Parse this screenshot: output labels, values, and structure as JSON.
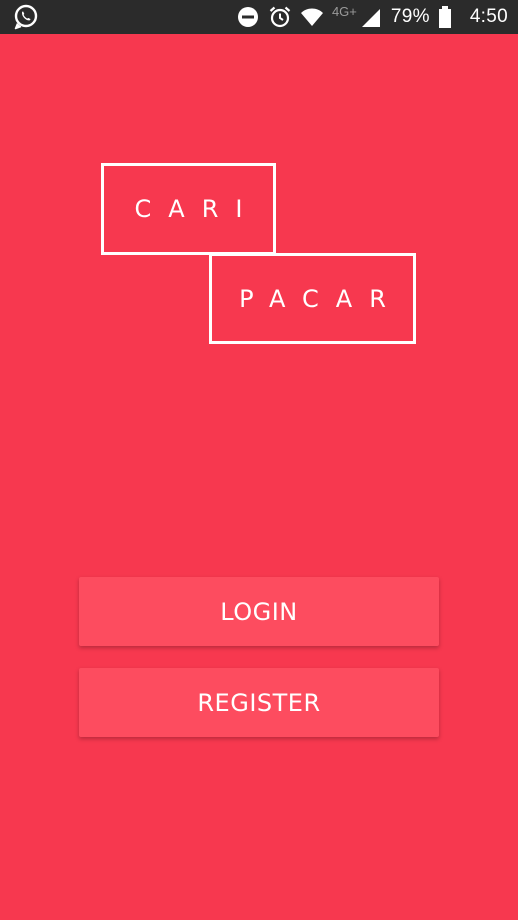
{
  "status_bar": {
    "network_label": "4G+",
    "battery_percent": "79%",
    "time": "4:50",
    "icons": [
      "whatsapp-icon",
      "do-not-disturb-icon",
      "alarm-icon",
      "wifi-icon",
      "cell-signal-icon",
      "battery-icon"
    ]
  },
  "logo": {
    "line1": "CARI",
    "line2": "PACAR"
  },
  "actions": {
    "login_label": "LOGIN",
    "register_label": "REGISTER"
  },
  "colors": {
    "background": "#f7384f",
    "button": "#fd4c5f",
    "status_bar": "#2b2b2b",
    "text": "#ffffff"
  }
}
